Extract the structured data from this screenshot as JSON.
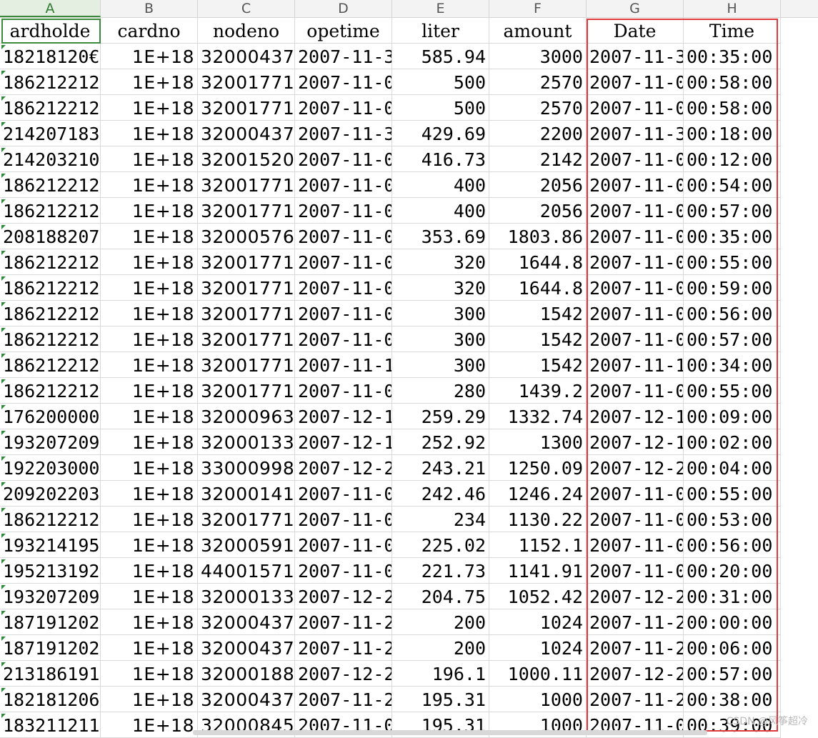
{
  "column_letters": [
    "A",
    "B",
    "C",
    "D",
    "E",
    "F",
    "G",
    "H"
  ],
  "active_column": "A",
  "headers": [
    "ardholde",
    "cardno",
    "nodeno",
    "opetime",
    "liter",
    "amount",
    "Date",
    "Time"
  ],
  "rows": [
    [
      "18218120€",
      "1E+18",
      "32000437",
      "2007-11-3",
      "585.94",
      "3000",
      "2007-11-3",
      "00:35:00"
    ],
    [
      "186212212",
      "1E+18",
      "32001771",
      "2007-11-0",
      "500",
      "2570",
      "2007-11-0",
      "00:58:00"
    ],
    [
      "186212212",
      "1E+18",
      "32001771",
      "2007-11-0",
      "500",
      "2570",
      "2007-11-0",
      "00:58:00"
    ],
    [
      "214207183",
      "1E+18",
      "32000437",
      "2007-11-3",
      "429.69",
      "2200",
      "2007-11-3",
      "00:18:00"
    ],
    [
      "214203210",
      "1E+18",
      "32001520",
      "2007-11-0",
      "416.73",
      "2142",
      "2007-11-0",
      "00:12:00"
    ],
    [
      "186212212",
      "1E+18",
      "32001771",
      "2007-11-0",
      "400",
      "2056",
      "2007-11-0",
      "00:54:00"
    ],
    [
      "186212212",
      "1E+18",
      "32001771",
      "2007-11-0",
      "400",
      "2056",
      "2007-11-0",
      "00:57:00"
    ],
    [
      "208188207",
      "1E+18",
      "32000576",
      "2007-11-0",
      "353.69",
      "1803.86",
      "2007-11-0",
      "00:35:00"
    ],
    [
      "186212212",
      "1E+18",
      "32001771",
      "2007-11-0",
      "320",
      "1644.8",
      "2007-11-0",
      "00:55:00"
    ],
    [
      "186212212",
      "1E+18",
      "32001771",
      "2007-11-0",
      "320",
      "1644.8",
      "2007-11-0",
      "00:59:00"
    ],
    [
      "186212212",
      "1E+18",
      "32001771",
      "2007-11-0",
      "300",
      "1542",
      "2007-11-0",
      "00:56:00"
    ],
    [
      "186212212",
      "1E+18",
      "32001771",
      "2007-11-0",
      "300",
      "1542",
      "2007-11-0",
      "00:57:00"
    ],
    [
      "186212212",
      "1E+18",
      "32001771",
      "2007-11-1",
      "300",
      "1542",
      "2007-11-1",
      "00:34:00"
    ],
    [
      "186212212",
      "1E+18",
      "32001771",
      "2007-11-0",
      "280",
      "1439.2",
      "2007-11-0",
      "00:55:00"
    ],
    [
      "176200000",
      "1E+18",
      "32000963",
      "2007-12-1",
      "259.29",
      "1332.74",
      "2007-12-1",
      "00:09:00"
    ],
    [
      "193207209",
      "1E+18",
      "32000133",
      "2007-12-1",
      "252.92",
      "1300",
      "2007-12-1",
      "00:02:00"
    ],
    [
      "192203000",
      "1E+18",
      "33000998",
      "2007-12-2",
      "243.21",
      "1250.09",
      "2007-12-2",
      "00:04:00"
    ],
    [
      "209202203",
      "1E+18",
      "32000141",
      "2007-11-0",
      "242.46",
      "1246.24",
      "2007-11-0",
      "00:55:00"
    ],
    [
      "186212212",
      "1E+18",
      "32001771",
      "2007-11-0",
      "234",
      "1130.22",
      "2007-11-0",
      "00:53:00"
    ],
    [
      "193214195",
      "1E+18",
      "32000591",
      "2007-11-0",
      "225.02",
      "1152.1",
      "2007-11-0",
      "00:56:00"
    ],
    [
      "195213192",
      "1E+18",
      "44001571",
      "2007-11-0",
      "221.73",
      "1141.91",
      "2007-11-0",
      "00:20:00"
    ],
    [
      "193207209",
      "1E+18",
      "32000133",
      "2007-12-2",
      "204.75",
      "1052.42",
      "2007-12-2",
      "00:31:00"
    ],
    [
      "187191202",
      "1E+18",
      "32000437",
      "2007-11-2",
      "200",
      "1024",
      "2007-11-2",
      "00:00:00"
    ],
    [
      "187191202",
      "1E+18",
      "32000437",
      "2007-11-2",
      "200",
      "1024",
      "2007-11-2",
      "00:06:00"
    ],
    [
      "213186191",
      "1E+18",
      "32000188",
      "2007-12-2",
      "196.1",
      "1000.11",
      "2007-12-2",
      "00:57:00"
    ],
    [
      "182181206",
      "1E+18",
      "32000437",
      "2007-11-2",
      "195.31",
      "1000",
      "2007-11-2",
      "00:38:00"
    ],
    [
      "183211211",
      "1E+18",
      "32000845",
      "2007-11-0",
      "195.31",
      "1000",
      "2007-11-0",
      "00:39:00"
    ]
  ],
  "watermark": "CSDN @风筝超冷",
  "colors": {
    "selection_green": "#3b8a3c",
    "highlight_red": "#e0393b",
    "header_bg": "#f3f3f3"
  }
}
